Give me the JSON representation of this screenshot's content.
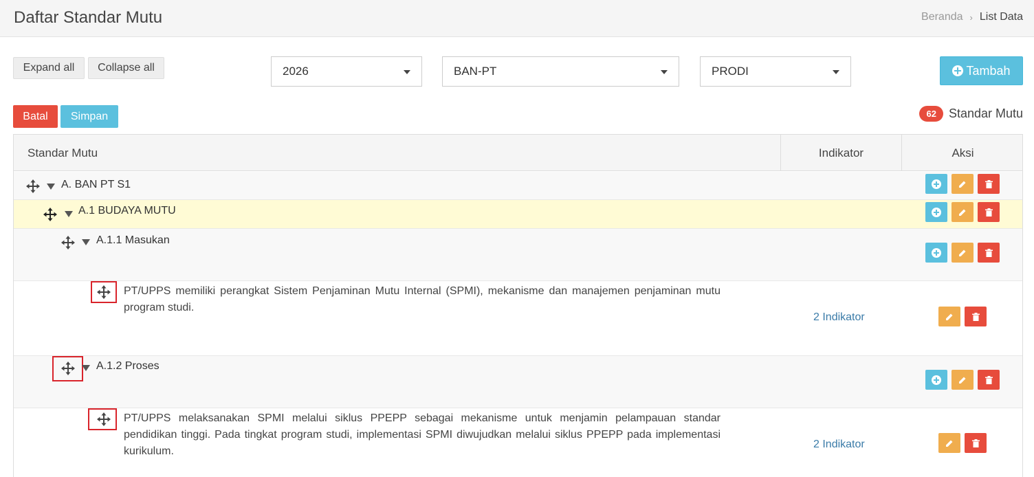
{
  "header": {
    "title": "Daftar Standar Mutu",
    "breadcrumb": {
      "home": "Beranda",
      "separator": "›",
      "current": "List Data"
    }
  },
  "toolbar": {
    "expand_all": "Expand all",
    "collapse_all": "Collapse all",
    "year_select": "2026",
    "accreditor_select": "BAN-PT",
    "level_select": "PRODI",
    "add_button": "Tambah",
    "cancel_button": "Batal",
    "save_button": "Simpan",
    "count_badge": "62",
    "count_label": "Standar Mutu"
  },
  "table": {
    "headers": {
      "standard": "Standar Mutu",
      "indicator": "Indikator",
      "actions": "Aksi"
    },
    "rows": [
      {
        "label": "A. BAN PT S1"
      },
      {
        "label": "A.1 BUDAYA MUTU"
      },
      {
        "label": "A.1.1 Masukan"
      },
      {
        "desc": "PT/UPPS memiliki perangkat Sistem Penjaminan Mutu Internal (SPMI), mekanisme dan manajemen penjaminan mutu program studi.",
        "indicator": "2 Indikator"
      },
      {
        "label": "A.1.2 Proses"
      },
      {
        "desc": "PT/UPPS melaksanakan SPMI melalui siklus PPEPP sebagai mekanisme untuk menjamin pelampauan standar pendidikan tinggi. Pada tingkat program studi, implementasi SPMI diwujudkan melalui siklus PPEPP pada implementasi kurikulum.",
        "indicator": "2 Indikator"
      }
    ]
  },
  "colors": {
    "info": "#5bc0de",
    "warning": "#f0ad4e",
    "danger": "#e74c3c",
    "highlight_row": "#fffbd5",
    "annotation_box": "#d9242b"
  },
  "icons": [
    "move-icon",
    "triangle-down-icon",
    "plus-circle-icon",
    "pencil-icon",
    "trash-icon",
    "caret-down-icon"
  ]
}
